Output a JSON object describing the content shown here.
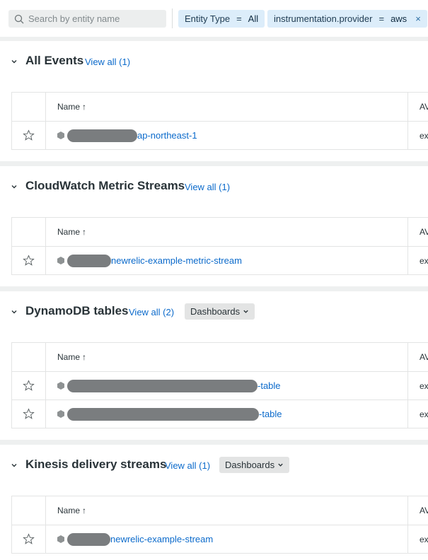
{
  "search": {
    "placeholder": "Search by entity name"
  },
  "filters": [
    {
      "key": "Entity Type",
      "op": "=",
      "value": "All"
    },
    {
      "key": "instrumentation.provider",
      "op": "=",
      "value": "aws",
      "remove": "×"
    }
  ],
  "table_header": {
    "name": "Name",
    "sort": "↑",
    "account": "AV"
  },
  "sections": [
    {
      "title": "All Events",
      "view_all": "View all (1)",
      "rows": [
        {
          "name_suffix": "ap-northeast-1",
          "account": "ex"
        }
      ]
    },
    {
      "title": "CloudWatch Metric Streams",
      "view_all": "View all (1)",
      "rows": [
        {
          "name_suffix": "newrelic-example-metric-stream",
          "account": "ex"
        }
      ]
    },
    {
      "title": "DynamoDB tables",
      "view_all": "View all (2)",
      "dashboards": "Dashboards",
      "rows": [
        {
          "name_suffix": "-table",
          "account": "ex"
        },
        {
          "name_suffix": "-table",
          "account": "ex"
        }
      ]
    },
    {
      "title": "Kinesis delivery streams",
      "view_all": "View all (1)",
      "dashboards": "Dashboards",
      "rows": [
        {
          "name_suffix": "newrelic-example-stream",
          "account": "ex"
        }
      ]
    }
  ],
  "colors": {
    "link": "#0b6acb",
    "pill_bg": "#dcedfa",
    "page_bg": "#eef0f0"
  },
  "icons": {
    "search": "search-icon",
    "collapse": "chevron-down-icon",
    "favorite": "star-outline-icon",
    "entity": "hexagon-icon"
  }
}
